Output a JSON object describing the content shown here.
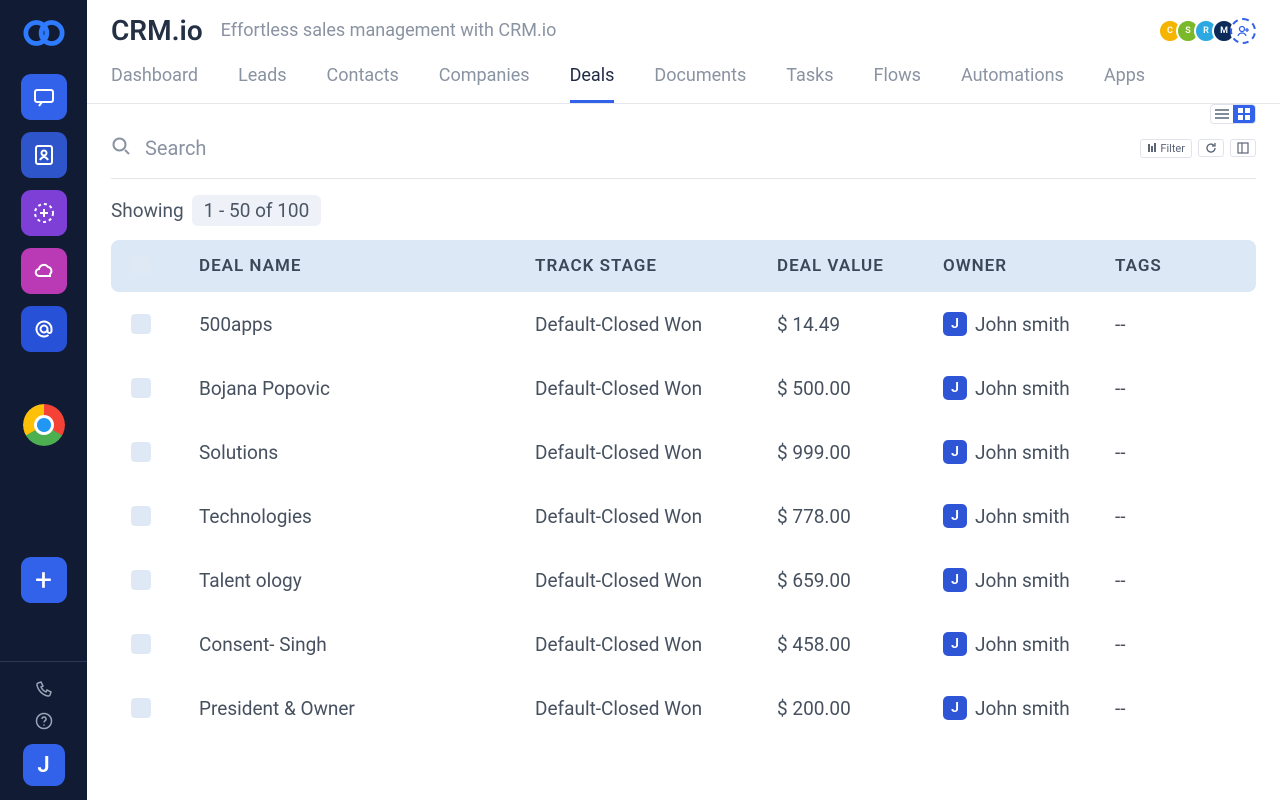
{
  "header": {
    "title": "CRM.io",
    "subtitle": "Effortless sales management with CRM.io",
    "avatars": [
      {
        "letter": "C",
        "color": "#f5b400"
      },
      {
        "letter": "S",
        "color": "#7ab929"
      },
      {
        "letter": "R",
        "color": "#2ca9e1"
      },
      {
        "letter": "M",
        "color": "#0b2a5a"
      }
    ]
  },
  "tabs": [
    {
      "label": "Dashboard",
      "active": false
    },
    {
      "label": "Leads",
      "active": false
    },
    {
      "label": "Contacts",
      "active": false
    },
    {
      "label": "Companies",
      "active": false
    },
    {
      "label": "Deals",
      "active": true
    },
    {
      "label": "Documents",
      "active": false
    },
    {
      "label": "Tasks",
      "active": false
    },
    {
      "label": "Flows",
      "active": false
    },
    {
      "label": "Automations",
      "active": false
    },
    {
      "label": "Apps",
      "active": false
    }
  ],
  "search": {
    "placeholder": "Search"
  },
  "filter_label": "Filter",
  "showing": {
    "label": "Showing",
    "range": "1 - 50 of 100"
  },
  "columns": {
    "name": "DEAL NAME",
    "stage": "TRACK STAGE",
    "value": "DEAL VALUE",
    "owner": "OWNER",
    "tags": "TAGS"
  },
  "rows": [
    {
      "name": "500apps",
      "stage": "Default-Closed Won",
      "value": "$ 14.49",
      "owner": "John smith",
      "owner_initial": "J",
      "tags": "--"
    },
    {
      "name": "Bojana Popovic",
      "stage": "Default-Closed Won",
      "value": "$ 500.00",
      "owner": "John smith",
      "owner_initial": "J",
      "tags": "--"
    },
    {
      "name": "Solutions",
      "stage": "Default-Closed Won",
      "value": "$ 999.00",
      "owner": "John smith",
      "owner_initial": "J",
      "tags": "--"
    },
    {
      "name": "Technologies",
      "stage": "Default-Closed Won",
      "value": "$ 778.00",
      "owner": "John smith",
      "owner_initial": "J",
      "tags": "--"
    },
    {
      "name": "Talent ology",
      "stage": "Default-Closed Won",
      "value": "$ 659.00",
      "owner": "John smith",
      "owner_initial": "J",
      "tags": "--"
    },
    {
      "name": "Consent- Singh",
      "stage": "Default-Closed Won",
      "value": "$ 458.00",
      "owner": "John smith",
      "owner_initial": "J",
      "tags": "--"
    },
    {
      "name": "President & Owner",
      "stage": "Default-Closed Won",
      "value": "$ 200.00",
      "owner": "John smith",
      "owner_initial": "J",
      "tags": "--"
    }
  ],
  "sidebar_avatar": "J"
}
